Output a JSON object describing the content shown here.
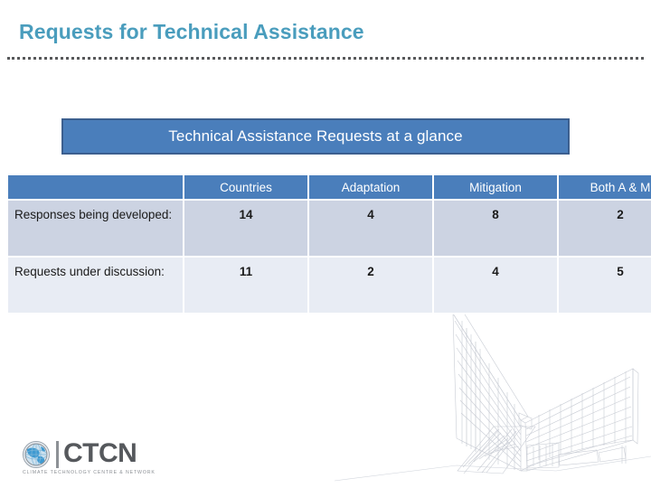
{
  "slide": {
    "title": "Requests for Technical Assistance",
    "banner_text": "Technical Assistance Requests at a glance"
  },
  "table": {
    "corner_header": "",
    "columns": [
      "Countries",
      "Adaptation",
      "Mitigation",
      "Both A & M"
    ],
    "rows": [
      {
        "label": "Responses being developed:",
        "values": [
          "14",
          "4",
          "8",
          "2"
        ]
      },
      {
        "label": "Requests under discussion:",
        "values": [
          "11",
          "2",
          "4",
          "5"
        ]
      }
    ]
  },
  "logo": {
    "wordmark": "CTCN",
    "tagline": "CLIMATE TECHNOLOGY CENTRE & NETWORK"
  },
  "colors": {
    "title_blue": "#4a9dbd",
    "banner_blue": "#4a7ebb",
    "banner_border": "#3c5f8f",
    "header_blue": "#4a7ebb",
    "row_odd": "#ccd3e2",
    "row_even": "#e8ecf4",
    "rule_gray": "#58595b",
    "logo_gray": "#55585c"
  }
}
